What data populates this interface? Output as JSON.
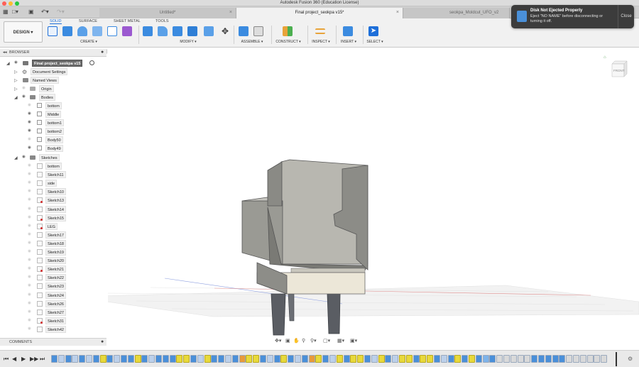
{
  "window": {
    "title": "Autodesk Fusion 360 (Education License)",
    "traffic_colors": [
      "#ff5f57",
      "#febc2e",
      "#28c840"
    ]
  },
  "tabs": [
    {
      "label": "Untitled*",
      "active": false
    },
    {
      "label": "Final project_seokpa v15*",
      "active": true
    },
    {
      "label": "seokpa_Moldcut_UFO_v2",
      "active": false
    }
  ],
  "ribbon": {
    "workspace_button": "DESIGN ▾",
    "tabs": [
      "SOLID",
      "SURFACE",
      "SHEET METAL",
      "TOOLS"
    ],
    "active_tab": "SOLID",
    "groups": [
      "CREATE ▾",
      "MODIFY ▾",
      "ASSEMBLE ▾",
      "CONSTRUCT ▾",
      "INSPECT ▾",
      "INSERT ▾",
      "SELECT ▾"
    ]
  },
  "notification": {
    "title": "Disk Not Ejected Properly",
    "body": "Eject \"NO NAME\" before disconnecting or turning it off.",
    "close_label": "Close"
  },
  "browser": {
    "header": "BROWSER",
    "root": "Final project_seokpa v15",
    "document_settings": "Document Settings",
    "named_views": "Named Views",
    "origin": "Origin",
    "bodies_label": "Bodies",
    "bodies": [
      {
        "label": "bottom",
        "visible": false
      },
      {
        "label": "Middle",
        "visible": true
      },
      {
        "label": "bottom1",
        "visible": true
      },
      {
        "label": "bottom2",
        "visible": true
      },
      {
        "label": "Body50",
        "visible": false
      },
      {
        "label": "Body49",
        "visible": true
      }
    ],
    "sketches_label": "Sketches",
    "sketches": [
      {
        "label": "bottom",
        "warn": false
      },
      {
        "label": "Sketch11",
        "warn": false
      },
      {
        "label": "side",
        "warn": false
      },
      {
        "label": "Sketch10",
        "warn": false
      },
      {
        "label": "Sketch13",
        "warn": true
      },
      {
        "label": "Sketch14",
        "warn": false
      },
      {
        "label": "Sketch15",
        "warn": true
      },
      {
        "label": "LEG",
        "warn": true
      },
      {
        "label": "Sketch17",
        "warn": false
      },
      {
        "label": "Sketch18",
        "warn": false
      },
      {
        "label": "Sketch19",
        "warn": false
      },
      {
        "label": "Sketch20",
        "warn": false
      },
      {
        "label": "Sketch21",
        "warn": true
      },
      {
        "label": "Sketch22",
        "warn": false
      },
      {
        "label": "Sketch23",
        "warn": false
      },
      {
        "label": "Sketch24",
        "warn": false
      },
      {
        "label": "Sketch26",
        "warn": false
      },
      {
        "label": "Sketch27",
        "warn": false
      },
      {
        "label": "Sketch31",
        "warn": true
      },
      {
        "label": "Sketch42",
        "warn": false
      }
    ]
  },
  "comments": {
    "header": "COMMENTS"
  },
  "viewcube": {
    "face": "FRONT"
  },
  "colors": {
    "accent": "#1e6fd9",
    "model_gray": "#9a9a94",
    "model_dark": "#6f6f6a",
    "tabletop": "#ece7d8",
    "legs": "#5a5d63"
  }
}
